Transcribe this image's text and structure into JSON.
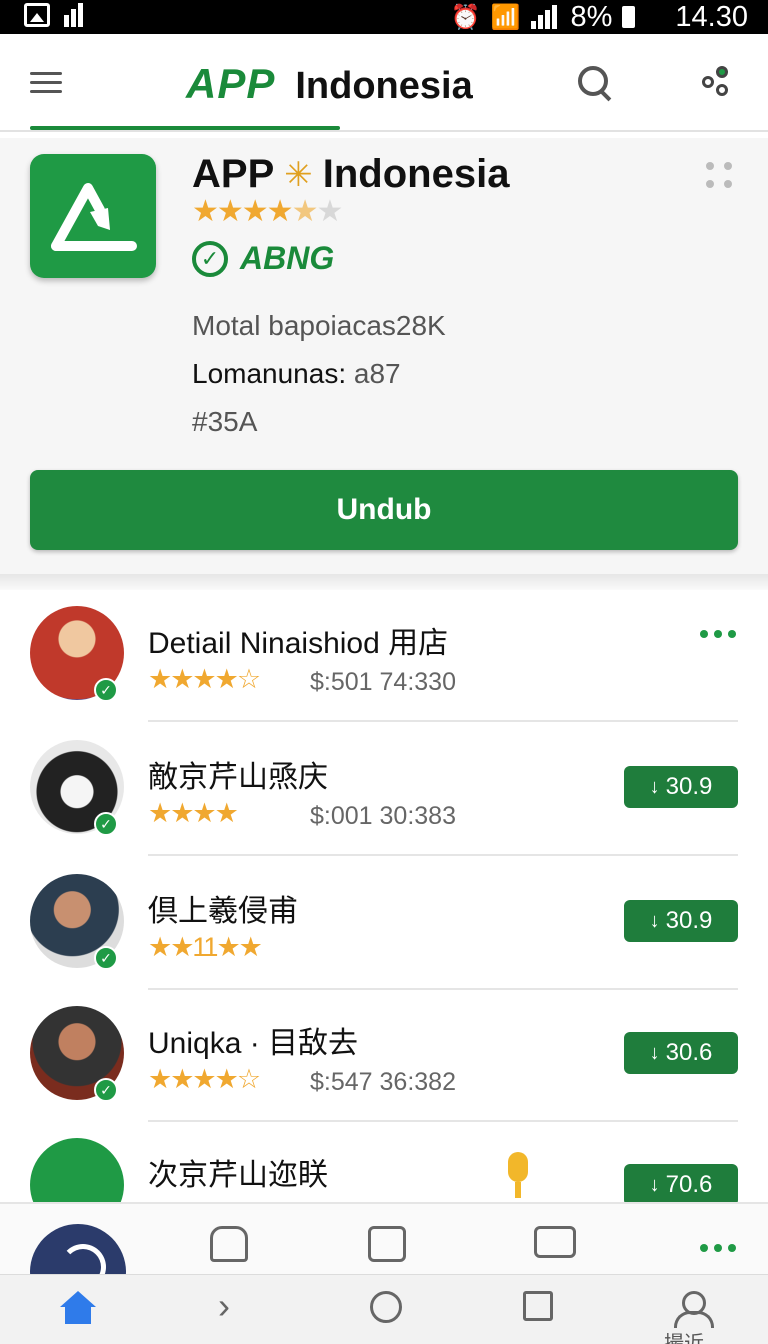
{
  "status_bar": {
    "battery": "8%",
    "time": "14.30",
    "icons": [
      "image-icon",
      "chart-icon",
      "alarm-icon",
      "wifi-icon",
      "signal-icon",
      "battery-icon"
    ]
  },
  "app_bar": {
    "brand_app": "APP",
    "brand_name": "Indonesia",
    "icons": [
      "menu-icon",
      "search-icon",
      "share-icon"
    ]
  },
  "app_card": {
    "title_app": "APP",
    "title_spark": "✳",
    "title_name": "Indonesia",
    "rating_stars": 4.5,
    "verified_label": "ABNG",
    "meta_line1": "Motal bapoiacas28K",
    "meta_line2_label": "Lomanunas:",
    "meta_line2_value": "a87",
    "meta_line3": "#35A",
    "download_label": "Undub"
  },
  "list": {
    "items": [
      {
        "title": "Detiail Ninaishiod 用店",
        "stars": "★★★★☆",
        "sub": "$:501 74:330",
        "action": "more",
        "avatar_color": "#c0392b"
      },
      {
        "title": "敵京芹山焏庆",
        "stars": "★★★★",
        "sub": "$:001 30:383",
        "pill": "30.9",
        "avatar_color": "#222222"
      },
      {
        "title": "倶上羲侵甫",
        "stars": "★★11★★",
        "sub": "",
        "pill": "30.9",
        "avatar_color": "#34495e"
      },
      {
        "title": "Uniqka · 目敌去",
        "stars": "★★★★☆",
        "sub": "$:547 36:382",
        "pill": "30.6",
        "avatar_color": "#7a2c1e"
      },
      {
        "title": "次京芹山迩眹",
        "stars": "",
        "sub": "",
        "pill": "70.6",
        "avatar_color": "#1f9a45"
      }
    ]
  },
  "bottom_nav": {
    "profile_label": "撮近"
  },
  "colors": {
    "brand_green": "#1f8a3f",
    "star": "#f0a830",
    "nav_active": "#2f7bea"
  }
}
